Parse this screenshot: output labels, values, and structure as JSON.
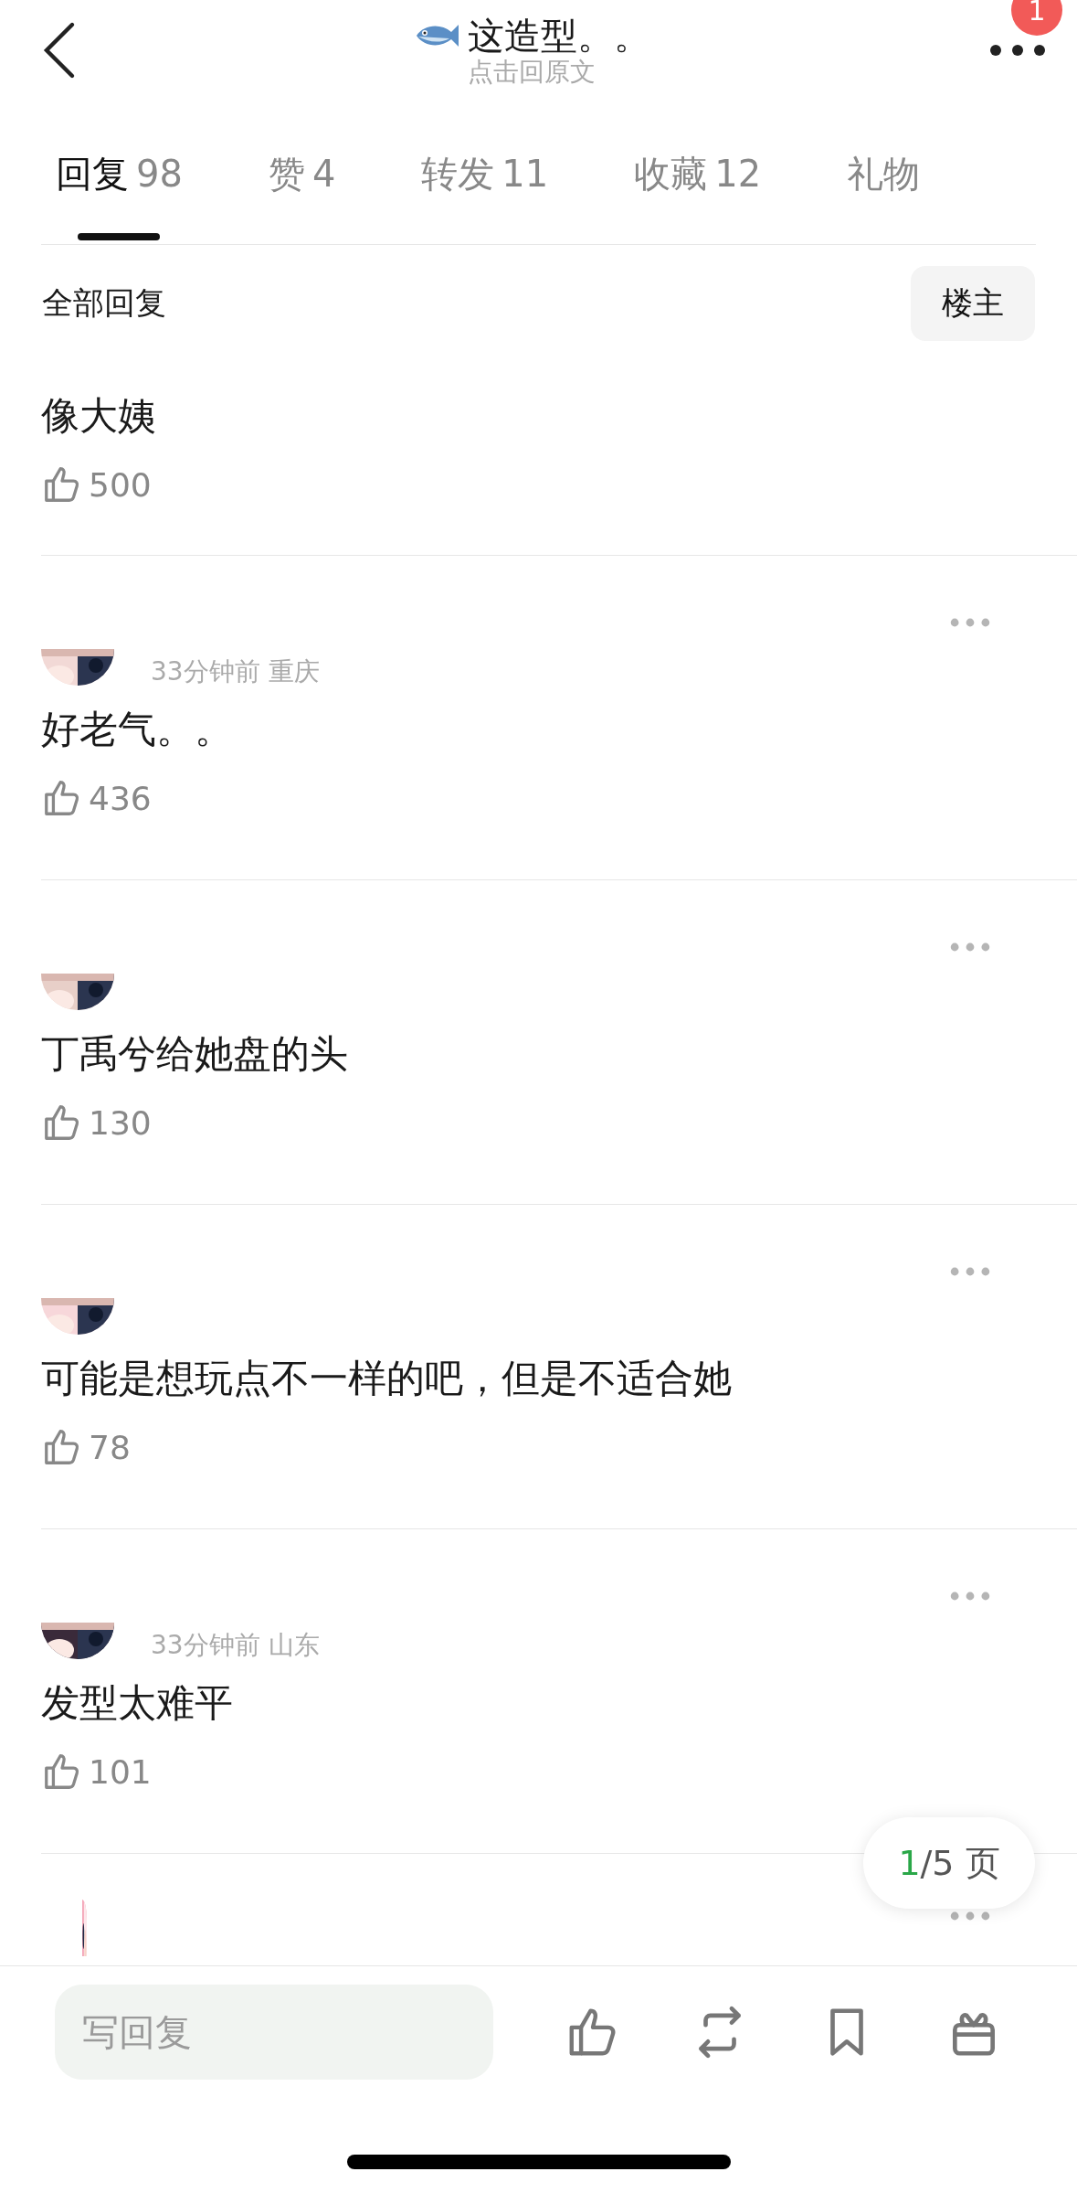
{
  "header": {
    "title": "这造型。。",
    "subtitle": "点击回原文",
    "notification_count": "1"
  },
  "tabs": [
    {
      "label": "回复",
      "count": "98",
      "selected": true
    },
    {
      "label": "赞",
      "count": "4",
      "selected": false
    },
    {
      "label": "转发",
      "count": "11",
      "selected": false
    },
    {
      "label": "收藏",
      "count": "12",
      "selected": false
    },
    {
      "label": "礼物",
      "selected": false
    }
  ],
  "filter": {
    "label": "全部回复",
    "button": "楼主"
  },
  "comments": [
    {
      "kind": "continued",
      "text": "像大姨",
      "likes": "500"
    },
    {
      "kind": "full",
      "meta": "33分钟前 重庆",
      "text": "好老气。。",
      "likes": "436"
    },
    {
      "kind": "full",
      "text": "丁禹兮给她盘的头",
      "likes": "130"
    },
    {
      "kind": "full",
      "text": "可能是想玩点不一样的吧，但是不适合她",
      "likes": "78"
    },
    {
      "kind": "full",
      "meta": "33分钟前 山东",
      "text": "发型太难平",
      "likes": "101"
    },
    {
      "kind": "header"
    }
  ],
  "pager": {
    "current": "1",
    "rest": "/5 页"
  },
  "compose": {
    "placeholder": "写回复"
  }
}
